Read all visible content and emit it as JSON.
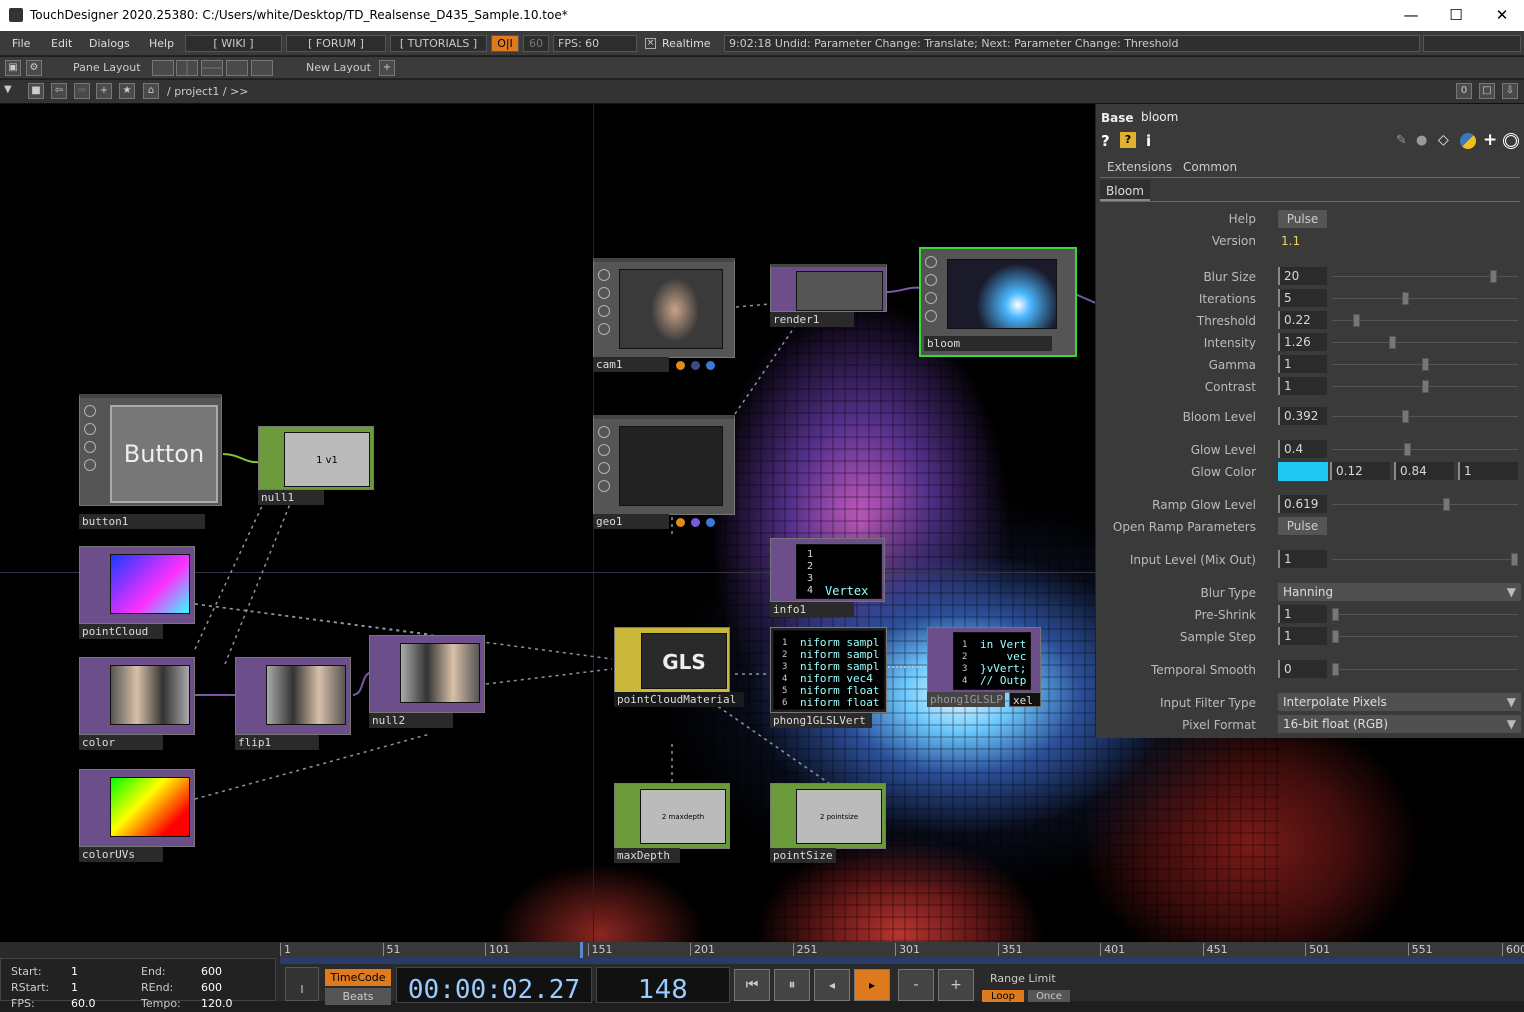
{
  "window": {
    "title": "TouchDesigner 2020.25380: C:/Users/white/Desktop/TD_Realsense_D435_Sample.10.toe*",
    "minimize": "—",
    "maximize": "☐",
    "close": "✕"
  },
  "menu": {
    "items": [
      "File",
      "Edit",
      "Dialogs",
      "Help"
    ],
    "wiki": "[ WIKI ]",
    "forum": "[ FORUM ]",
    "tutorials": "[ TUTORIALS ]",
    "oi": "O|I",
    "fps_value": "60",
    "fps_label": "FPS:  60",
    "realtime": "Realtime",
    "status": "9:02:18 Undid: Parameter Change: Translate; Next: Parameter Change: Threshold"
  },
  "toolbar2": {
    "pane_layout": "Pane Layout",
    "new_layout": "New Layout"
  },
  "toolbar3": {
    "path": "/ project1 / >>",
    "counter": "0"
  },
  "nodes": {
    "cam1": "cam1",
    "render1": "render1",
    "bloom": "bloom",
    "geo1": "geo1",
    "info1": "info1",
    "button1": "button1",
    "button_text": "Button",
    "null1": "null1",
    "null1_text": "1 v1",
    "pointCloud": "pointCloud",
    "color": "color",
    "flip1": "flip1",
    "null2": "null2",
    "colorUVs": "colorUVs",
    "gls_text": "GLS",
    "pointCloudMaterial": "pointCloudMaterial",
    "phong1GLSLVert": "phong1GLSLVert",
    "phong1GLSLP": "phong1GLSLP",
    "xel": "xel",
    "maxDepth": "maxDepth",
    "maxDepth_text": "2  maxdepth",
    "pointSize": "pointSize",
    "pointSize_text": "2  pointsize",
    "info_lines": [
      "1",
      "2",
      "3",
      "4"
    ],
    "info_vertex": "Vertex",
    "vert_nums": [
      "1",
      "2",
      "3",
      "4",
      "5",
      "6"
    ],
    "vert_code": [
      "niform sampl",
      "niform sampl",
      "niform sampl",
      "niform vec4",
      "niform float",
      "niform float"
    ],
    "pix_nums": [
      "1",
      "2",
      "3",
      "4"
    ],
    "pix_code": [
      "in Vert",
      "    vec",
      "}vVert;",
      "// Outp"
    ]
  },
  "param": {
    "tab": "Base",
    "name": "bloom",
    "pages": [
      "Extensions",
      "Common"
    ],
    "page_active": "Bloom",
    "help_label": "Help",
    "help_btn": "Pulse",
    "version_label": "Version",
    "version": "1.1",
    "rows": [
      {
        "label": "Blur Size",
        "value": "20",
        "knob": 0.88
      },
      {
        "label": "Iterations",
        "value": "5",
        "knob": 0.39
      },
      {
        "label": "Threshold",
        "value": "0.22",
        "knob": 0.12
      },
      {
        "label": "Intensity",
        "value": "1.26",
        "knob": 0.32
      },
      {
        "label": "Gamma",
        "value": "1",
        "knob": 0.5
      },
      {
        "label": "Contrast",
        "value": "1",
        "knob": 0.5
      }
    ],
    "bloom_level_label": "Bloom Level",
    "bloom_level": "0.392",
    "bloom_level_knob": 0.39,
    "glow_level_label": "Glow Level",
    "glow_level": "0.4",
    "glow_level_knob": 0.4,
    "glow_color_label": "Glow Color",
    "glow_color": "#1ec8f0",
    "glow_r": "0.12",
    "glow_g": "0.84",
    "glow_a": "1",
    "ramp_label": "Ramp Glow Level",
    "ramp": "0.619",
    "ramp_knob": 0.62,
    "open_ramp_label": "Open Ramp Parameters",
    "open_ramp_btn": "Pulse",
    "input_level_label": "Input Level (Mix Out)",
    "input_level": "1",
    "input_level_knob": 1.0,
    "blur_type_label": "Blur Type",
    "blur_type": "Hanning",
    "preshrink_label": "Pre-Shrink",
    "preshrink": "1",
    "preshrink_knob": 0.0,
    "sample_step_label": "Sample Step",
    "sample_step": "1",
    "sample_step_knob": 0.0,
    "temporal_label": "Temporal Smooth",
    "temporal": "0",
    "temporal_knob": 0.0,
    "filter_label": "Input Filter Type",
    "filter": "Interpolate Pixels",
    "pixfmt_label": "Pixel Format",
    "pixfmt": "16-bit float (RGB)"
  },
  "timeline": {
    "ticks": [
      "1",
      "51",
      "101",
      "151",
      "201",
      "251",
      "301",
      "351",
      "401",
      "451",
      "501",
      "551",
      "600"
    ],
    "start_label": "Start:",
    "start": "1",
    "end_label": "End:",
    "end": "600",
    "rstart_label": "RStart:",
    "rstart": "1",
    "rend_label": "REnd:",
    "rend": "600",
    "fps_label": "FPS:",
    "fps": "60.0",
    "tempo_label": "Tempo:",
    "tempo": "120.0",
    "timecode_btn": "TimeCode",
    "beats_btn": "Beats",
    "timecode": "00:00:02.27",
    "frame": "148",
    "range_limit": "Range Limit",
    "loop": "Loop",
    "once": "Once",
    "i": "I",
    "minus": "-",
    "plus": "+"
  }
}
